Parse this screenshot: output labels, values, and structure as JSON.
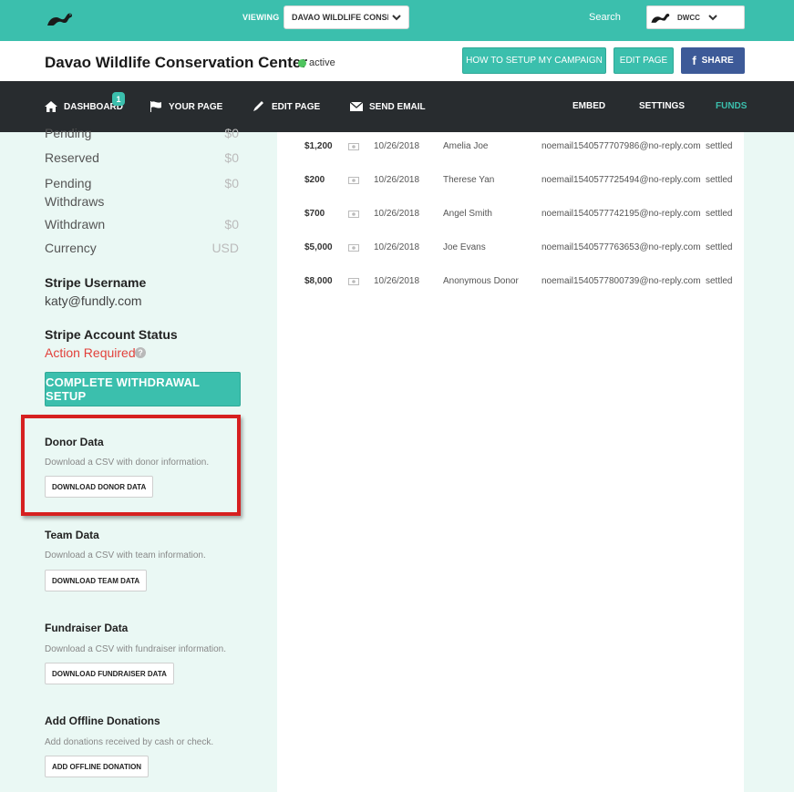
{
  "topbar": {
    "viewing_label": "VIEWING",
    "viewing_value": "DAVAO WILDLIFE CONSE...",
    "search_label": "Search",
    "account_value": "DWCC"
  },
  "campaign": {
    "title": "Davao Wildlife Conservation Center",
    "status": "active",
    "howto_label": "HOW TO SETUP MY CAMPAIGN",
    "editpage_label": "EDIT PAGE",
    "share_label": "SHARE",
    "share_icon": "f"
  },
  "nav": {
    "dashboard": "DASHBOARD",
    "dashboard_badge": "1",
    "yourpage": "YOUR PAGE",
    "editpage": "EDIT PAGE",
    "sendemail": "SEND EMAIL",
    "embed": "EMBED",
    "settings": "SETTINGS",
    "funds": "FUNDS"
  },
  "balances": [
    {
      "label": "Pending",
      "value": "$0"
    },
    {
      "label": "Reserved",
      "value": "$0"
    },
    {
      "label": "Pending",
      "label2": "Withdraws",
      "value": "$0"
    },
    {
      "label": "Withdrawn",
      "value": "$0"
    },
    {
      "label": "Currency",
      "value": "USD"
    }
  ],
  "stripe": {
    "username_title": "Stripe Username",
    "username_value": "katy@fundly.com",
    "status_title": "Stripe Account Status",
    "status_value": "Action Required",
    "help_icon": "?",
    "withdraw_button": "COMPLETE WITHDRAWAL SETUP"
  },
  "downloads": {
    "donor": {
      "title": "Donor Data",
      "desc": "Download a CSV with donor information.",
      "button": "DOWNLOAD DONOR DATA"
    },
    "team": {
      "title": "Team Data",
      "desc": "Download a CSV with team information.",
      "button": "DOWNLOAD TEAM DATA"
    },
    "fundraiser": {
      "title": "Fundraiser Data",
      "desc": "Download a CSV with fundraiser information.",
      "button": "DOWNLOAD FUNDRAISER DATA"
    },
    "offline": {
      "title": "Add Offline Donations",
      "desc": "Add donations received by cash or check.",
      "button": "ADD OFFLINE DONATION"
    }
  },
  "transactions": [
    {
      "amount": "$1,200",
      "date": "10/26/2018",
      "name": "Amelia Joe",
      "email": "noemail1540577707986@no-reply.com",
      "status": "settled"
    },
    {
      "amount": "$200",
      "date": "10/26/2018",
      "name": "Therese Yan",
      "email": "noemail1540577725494@no-reply.com",
      "status": "settled"
    },
    {
      "amount": "$700",
      "date": "10/26/2018",
      "name": "Angel Smith",
      "email": "noemail1540577742195@no-reply.com",
      "status": "settled"
    },
    {
      "amount": "$5,000",
      "date": "10/26/2018",
      "name": "Joe Evans",
      "email": "noemail1540577763653@no-reply.com",
      "status": "settled"
    },
    {
      "amount": "$8,000",
      "date": "10/26/2018",
      "name": "Anonymous Donor",
      "email": "noemail1540577800739@no-reply.com",
      "status": "settled"
    }
  ],
  "colors": {
    "teal": "#3bbfad",
    "dark_nav": "#282c2f",
    "alert_red": "#e2413b",
    "highlight_red": "#d62020",
    "facebook_blue": "#3d5a98"
  }
}
